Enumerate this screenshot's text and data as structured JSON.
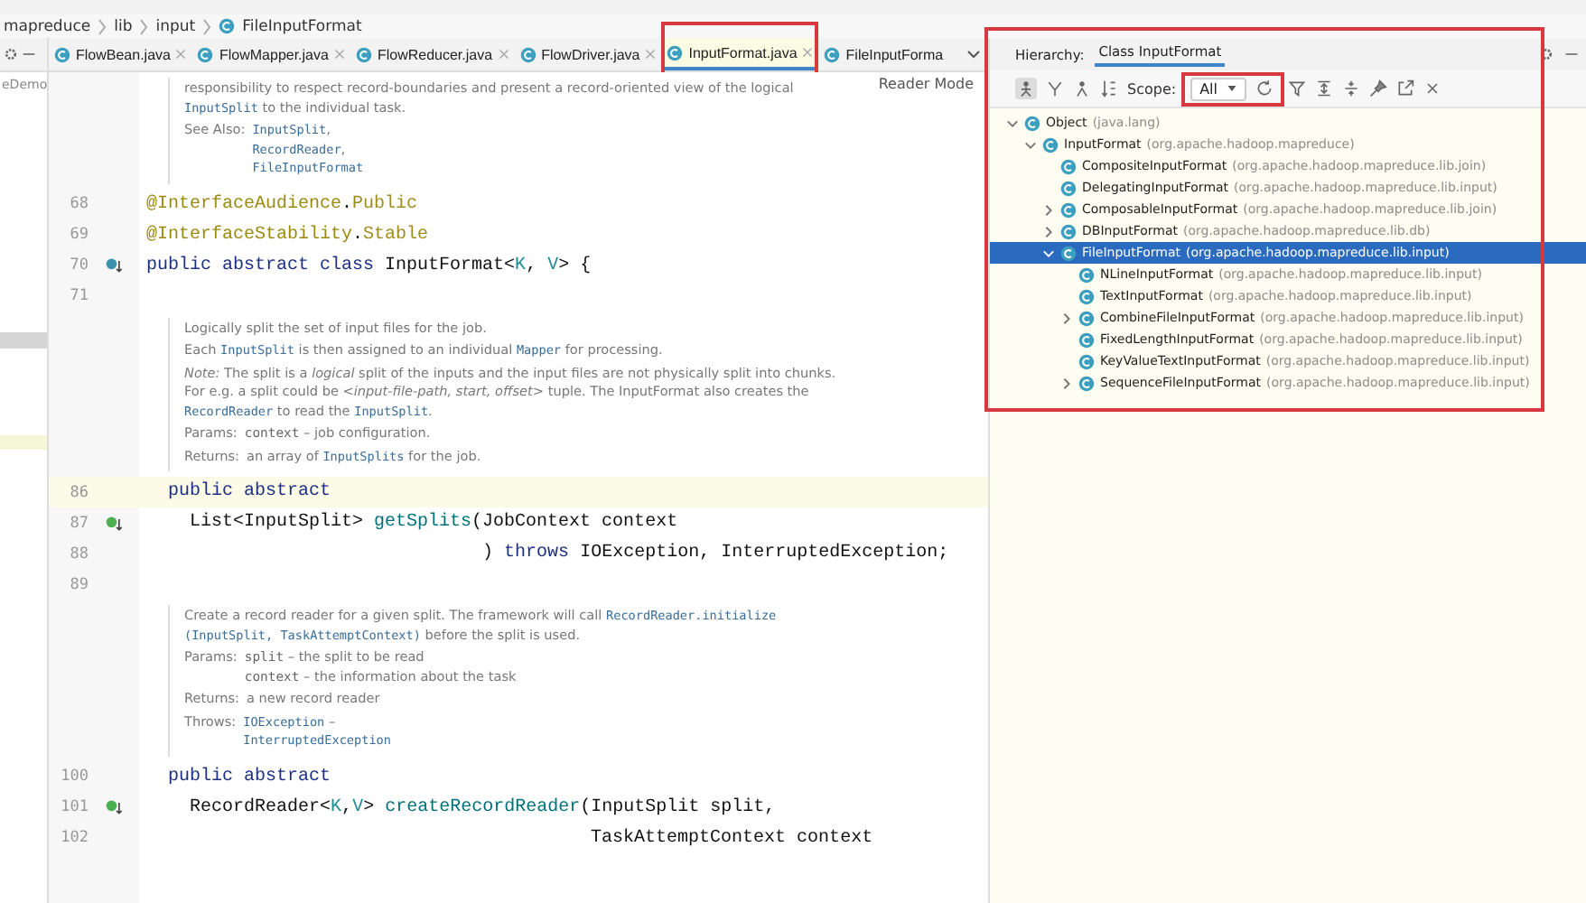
{
  "breadcrumb": [
    "mapreduce",
    "lib",
    "input",
    "FileInputFormat"
  ],
  "project_panel": {
    "label": "eDemo"
  },
  "tabs": [
    {
      "label": "FlowBean.java",
      "selected": false
    },
    {
      "label": "FlowMapper.java",
      "selected": false
    },
    {
      "label": "FlowReducer.java",
      "selected": false
    },
    {
      "label": "FlowDriver.java",
      "selected": false
    },
    {
      "label": "InputFormat.java",
      "selected": true
    },
    {
      "label": "FileInputForma",
      "selected": false
    }
  ],
  "editor": {
    "reader_mode": "Reader Mode",
    "blocks": [
      {
        "kind": "doc",
        "items": [
          {
            "kind": "para",
            "segments": [
              {
                "t": "responsibility to respect record-boundaries and present a record-oriented view of the logical "
              },
              {
                "t": "InputSplit",
                "kind": "code"
              },
              {
                "t": " to the individual task."
              }
            ]
          },
          {
            "kind": "field",
            "label": "See Also:",
            "lines": [
              [
                {
                  "t": "InputSplit",
                  "kind": "code"
                },
                {
                  "t": ","
                }
              ],
              [
                {
                  "t": "RecordReader",
                  "kind": "code"
                },
                {
                  "t": ","
                }
              ],
              [
                {
                  "t": "FileInputFormat",
                  "kind": "code"
                }
              ]
            ]
          }
        ]
      },
      {
        "kind": "code",
        "number": "68",
        "tokens": [
          {
            "t": "@InterfaceAudience",
            "kind": "annotation"
          },
          {
            "t": "."
          },
          {
            "t": "Public",
            "kind": "annotation-value"
          }
        ]
      },
      {
        "kind": "code",
        "number": "69",
        "tokens": [
          {
            "t": "@InterfaceStability",
            "kind": "annotation"
          },
          {
            "t": "."
          },
          {
            "t": "Stable",
            "kind": "annotation-value"
          }
        ]
      },
      {
        "kind": "code",
        "number": "70",
        "marker": {
          "kind": "implemented"
        },
        "tokens": [
          {
            "t": "public abstract class ",
            "kind": "keyword"
          },
          {
            "t": "InputFormat<"
          },
          {
            "t": "K",
            "kind": "type-param"
          },
          {
            "t": ", "
          },
          {
            "t": "V",
            "kind": "type-param"
          },
          {
            "t": "> {"
          }
        ]
      },
      {
        "kind": "code",
        "number": "71"
      },
      {
        "kind": "doc",
        "items": [
          {
            "kind": "para",
            "segments": [
              {
                "t": "Logically split the set of input files for the job."
              }
            ]
          },
          {
            "kind": "para",
            "segments": [
              {
                "t": "Each "
              },
              {
                "t": "InputSplit",
                "kind": "code"
              },
              {
                "t": " is then assigned to an individual "
              },
              {
                "t": "Mapper",
                "kind": "code"
              },
              {
                "t": " for processing."
              }
            ]
          },
          {
            "kind": "para",
            "segments": [
              {
                "t": "Note:",
                "kind": "italic"
              },
              {
                "t": " The split is a "
              },
              {
                "t": "logical",
                "kind": "italic"
              },
              {
                "t": " split of the inputs and the input files are not physically split into chunks. For e.g. a split could be "
              },
              {
                "t": "<input-file-path, start, offset>",
                "kind": "italic"
              },
              {
                "t": " tuple. The InputFormat also creates the "
              },
              {
                "t": "RecordReader",
                "kind": "code"
              },
              {
                "t": " to read the "
              },
              {
                "t": "InputSplit",
                "kind": "code"
              },
              {
                "t": "."
              }
            ]
          },
          {
            "kind": "field",
            "label": "Params:",
            "lines": [
              [
                {
                  "t": "context",
                  "kind": "code-plain"
                },
                {
                  "t": " – job configuration."
                }
              ]
            ]
          },
          {
            "kind": "field",
            "label": "Returns:",
            "lines": [
              [
                {
                  "t": "an array of "
                },
                {
                  "t": "InputSplits",
                  "kind": "code"
                },
                {
                  "t": " for the job."
                }
              ]
            ]
          }
        ]
      },
      {
        "kind": "code",
        "number": "86",
        "current": true,
        "tokens": [
          {
            "t": "  public abstract",
            "kind": "keyword"
          }
        ]
      },
      {
        "kind": "code",
        "number": "87",
        "marker": {
          "kind": "overrides"
        },
        "tokens": [
          {
            "t": "    List<InputSplit> "
          },
          {
            "t": "getSplits",
            "kind": "method"
          },
          {
            "t": "(JobContext context"
          }
        ]
      },
      {
        "kind": "code",
        "number": "88",
        "tokens": [
          {
            "t": "                               ) "
          },
          {
            "t": "throws ",
            "kind": "keyword"
          },
          {
            "t": "IOException, InterruptedException;"
          }
        ]
      },
      {
        "kind": "code",
        "number": "89"
      },
      {
        "kind": "doc",
        "items": [
          {
            "kind": "para",
            "segments": [
              {
                "t": "Create a record reader for a given split. The framework will call "
              },
              {
                "t": "RecordReader.initialize (InputSplit, TaskAttemptContext)",
                "kind": "code"
              },
              {
                "t": " before the split is used."
              }
            ]
          },
          {
            "kind": "field",
            "label": "Params:",
            "lines": [
              [
                {
                  "t": "split",
                  "kind": "code-plain"
                },
                {
                  "t": " – the split to be read"
                }
              ],
              [
                {
                  "t": "context",
                  "kind": "code-plain"
                },
                {
                  "t": " – the information about the task"
                }
              ]
            ]
          },
          {
            "kind": "field",
            "label": "Returns:",
            "lines": [
              [
                {
                  "t": "a new record reader"
                }
              ]
            ]
          },
          {
            "kind": "field",
            "label": "Throws:",
            "lines": [
              [
                {
                  "t": "IOException",
                  "kind": "code"
                },
                {
                  "t": " –"
                }
              ],
              [
                {
                  "t": "InterruptedException",
                  "kind": "code"
                }
              ]
            ]
          }
        ]
      },
      {
        "kind": "code",
        "number": "100",
        "tokens": [
          {
            "t": "  public abstract",
            "kind": "keyword"
          }
        ]
      },
      {
        "kind": "code",
        "number": "101",
        "marker": {
          "kind": "overrides"
        },
        "tokens": [
          {
            "t": "    RecordReader<"
          },
          {
            "t": "K",
            "kind": "type-param"
          },
          {
            "t": ","
          },
          {
            "t": "V",
            "kind": "type-param"
          },
          {
            "t": "> "
          },
          {
            "t": "createRecordReader",
            "kind": "method"
          },
          {
            "t": "(InputSplit split,"
          }
        ]
      },
      {
        "kind": "code",
        "number": "102",
        "tokens": [
          {
            "t": "                                         TaskAttemptContext context"
          }
        ]
      }
    ]
  },
  "hierarchy": {
    "title": "Hierarchy:",
    "tab": "Class InputFormat",
    "scope_label": "Scope:",
    "scope_value": "All",
    "tree": [
      {
        "name": "Object",
        "package": "(java.lang)",
        "expanded": true,
        "selected": false,
        "children": [
          {
            "name": "InputFormat",
            "package": "(org.apache.hadoop.mapreduce)",
            "expanded": true,
            "selected": false,
            "children": [
              {
                "name": "CompositeInputFormat",
                "package": "(org.apache.hadoop.mapreduce.lib.join)",
                "selected": false
              },
              {
                "name": "DelegatingInputFormat",
                "package": "(org.apache.hadoop.mapreduce.lib.input)",
                "selected": false
              },
              {
                "name": "ComposableInputFormat",
                "package": "(org.apache.hadoop.mapreduce.lib.join)",
                "expanded": false,
                "selected": false
              },
              {
                "name": "DBInputFormat",
                "package": "(org.apache.hadoop.mapreduce.lib.db)",
                "expanded": false,
                "selected": false
              },
              {
                "name": "FileInputFormat",
                "package": "(org.apache.hadoop.mapreduce.lib.input)",
                "expanded": true,
                "selected": true,
                "children": [
                  {
                    "name": "NLineInputFormat",
                    "package": "(org.apache.hadoop.mapreduce.lib.input)",
                    "selected": false
                  },
                  {
                    "name": "TextInputFormat",
                    "package": "(org.apache.hadoop.mapreduce.lib.input)",
                    "selected": false
                  },
                  {
                    "name": "CombineFileInputFormat",
                    "package": "(org.apache.hadoop.mapreduce.lib.input)",
                    "expanded": false,
                    "selected": false
                  },
                  {
                    "name": "FixedLengthInputFormat",
                    "package": "(org.apache.hadoop.mapreduce.lib.input)",
                    "selected": false
                  },
                  {
                    "name": "KeyValueTextInputFormat",
                    "package": "(org.apache.hadoop.mapreduce.lib.input)",
                    "selected": false
                  },
                  {
                    "name": "SequenceFileInputFormat",
                    "package": "(org.apache.hadoop.mapreduce.lib.input)",
                    "expanded": false,
                    "selected": false
                  }
                ]
              }
            ]
          }
        ]
      }
    ]
  }
}
